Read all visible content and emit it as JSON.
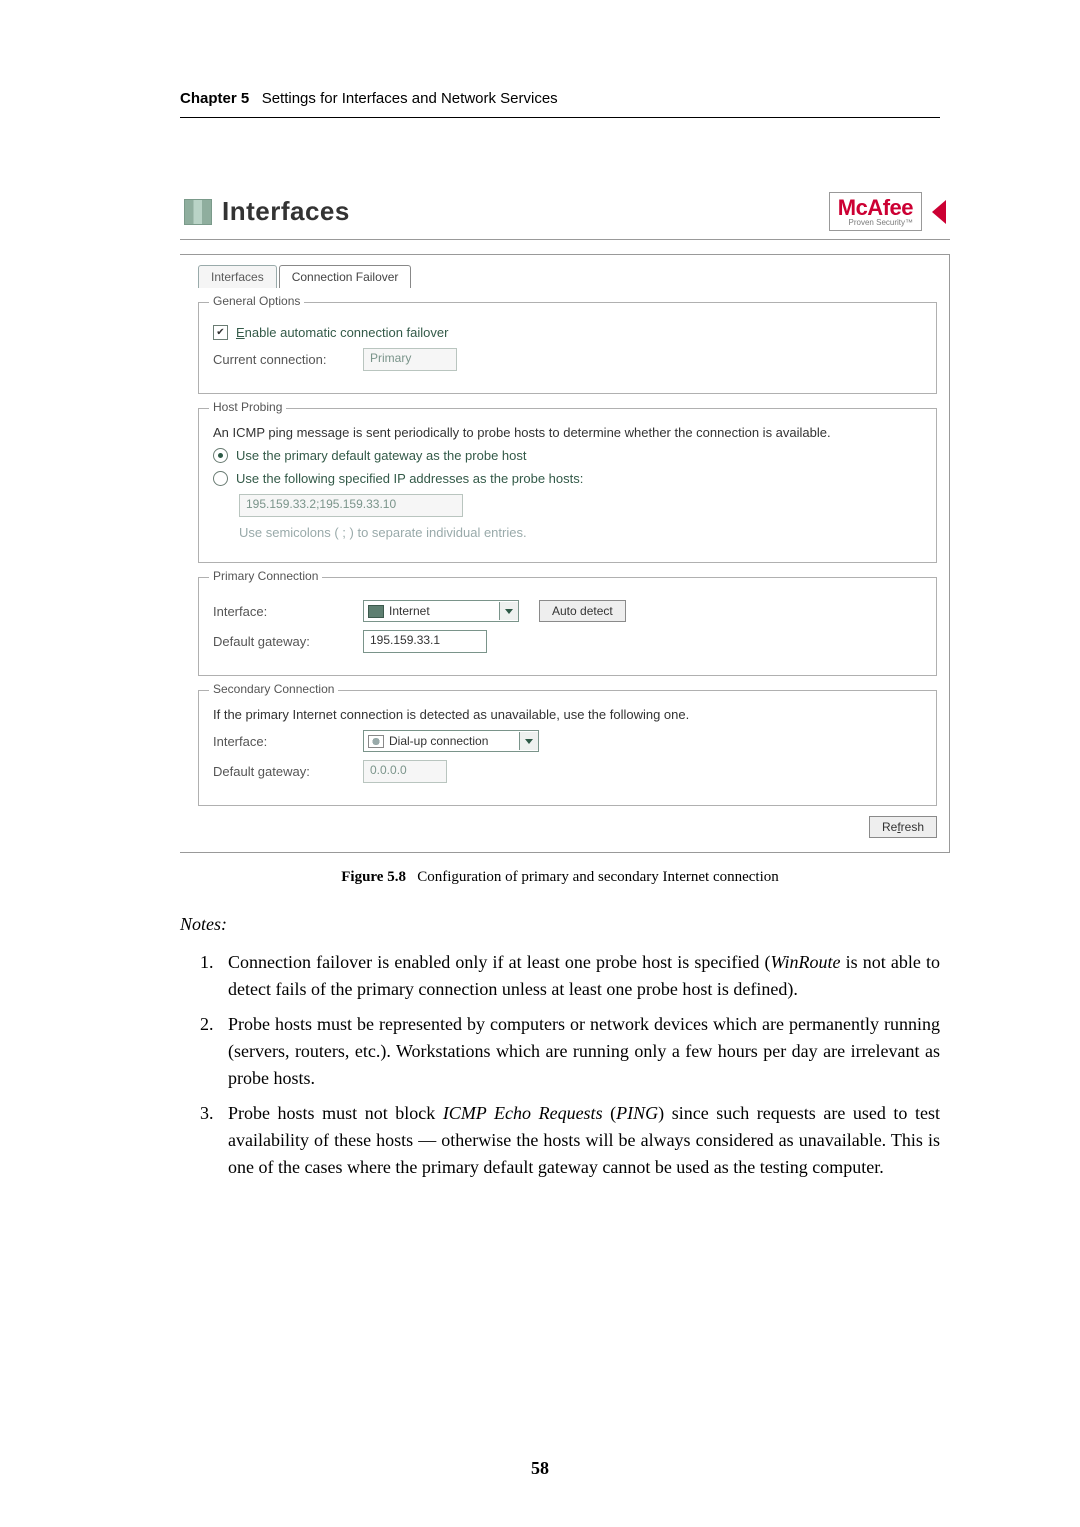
{
  "header": {
    "chapter_label": "Chapter 5",
    "chapter_title": "Settings for Interfaces and Network Services"
  },
  "screenshot": {
    "title": "Interfaces",
    "brand": {
      "name": "McAfee",
      "tagline": "Proven Security™"
    },
    "tabs": {
      "back": "Interfaces",
      "front": "Connection Failover"
    },
    "general": {
      "legend": "General Options",
      "enable_checked": true,
      "enable_label_pre": "E",
      "enable_label_rest": "nable automatic connection failover",
      "current_conn_label": "Current connection:",
      "current_conn_value": "Primary"
    },
    "probing": {
      "legend": "Host Probing",
      "desc": "An ICMP ping message is sent periodically to probe hosts to determine whether the connection is available.",
      "radio1_label": "Use the primary default gateway as the probe host",
      "radio2_label": "Use the following specified IP addresses as the probe hosts:",
      "ip_value": "195.159.33.2;195.159.33.10",
      "hint": "Use semicolons ( ; ) to separate individual entries."
    },
    "primary": {
      "legend": "Primary Connection",
      "iface_label": "Interface:",
      "iface_value": "Internet",
      "auto_detect": "Auto detect",
      "gw_label": "Default gateway:",
      "gw_value": "195.159.33.1"
    },
    "secondary": {
      "legend": "Secondary Connection",
      "desc": "If the primary Internet connection is detected as unavailable, use the following one.",
      "iface_label": "Interface:",
      "iface_value": "Dial-up connection",
      "gw_label": "Default gateway:",
      "gw_value": "0.0.0.0"
    },
    "refresh_pre": "Re",
    "refresh_u": "f",
    "refresh_post": "resh"
  },
  "caption": {
    "figno": "Figure 5.8",
    "text": "Configuration of primary and secondary Internet connection"
  },
  "notes": {
    "heading": "Notes:",
    "items": {
      "n1a": "Connection failover is enabled only if at least one probe host is specified (",
      "n1b": "WinRoute",
      "n1c": " is not able to detect fails of the primary connection unless at least one probe host is defined).",
      "n2": "Probe hosts must be represented by computers or network devices which are permanently running (servers, routers, etc.). Workstations which are running only a few hours per day are irrelevant as probe hosts.",
      "n3a": "Probe hosts must not block ",
      "n3b": "ICMP Echo Requests",
      "n3c": " (",
      "n3d": "PING",
      "n3e": ") since such requests are used to test availability of these hosts — otherwise the hosts will be always considered as unavailable. This is one of the cases where the primary default gateway cannot be used as the testing computer."
    }
  },
  "page_number": "58"
}
